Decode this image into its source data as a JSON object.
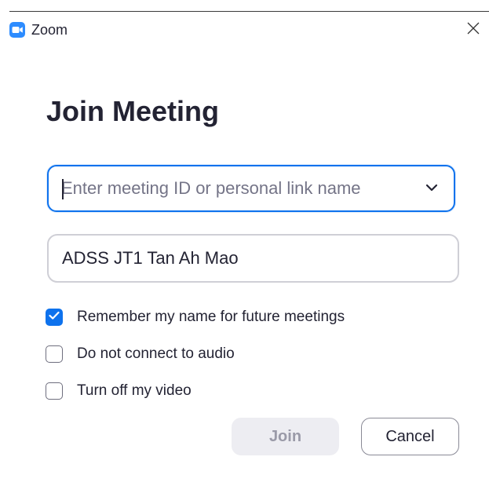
{
  "window": {
    "app_title": "Zoom",
    "app_icon": "zoom-camera-icon",
    "close_icon": "close-icon"
  },
  "dialog": {
    "heading": "Join Meeting",
    "meeting_id": {
      "value": "",
      "placeholder": "Enter meeting ID or personal link name",
      "dropdown_icon": "chevron-down-icon"
    },
    "display_name": {
      "value": "ADSS JT1 Tan Ah Mao"
    },
    "options": [
      {
        "label": "Remember my name for future meetings",
        "checked": true
      },
      {
        "label": "Do not connect to audio",
        "checked": false
      },
      {
        "label": "Turn off my video",
        "checked": false
      }
    ],
    "join_label": "Join",
    "cancel_label": "Cancel"
  },
  "colors": {
    "accent": "#0e72ed",
    "text": "#232333",
    "placeholder": "#747487",
    "disabled_button_bg": "#ededf2",
    "disabled_button_text": "#9a9aa8"
  }
}
